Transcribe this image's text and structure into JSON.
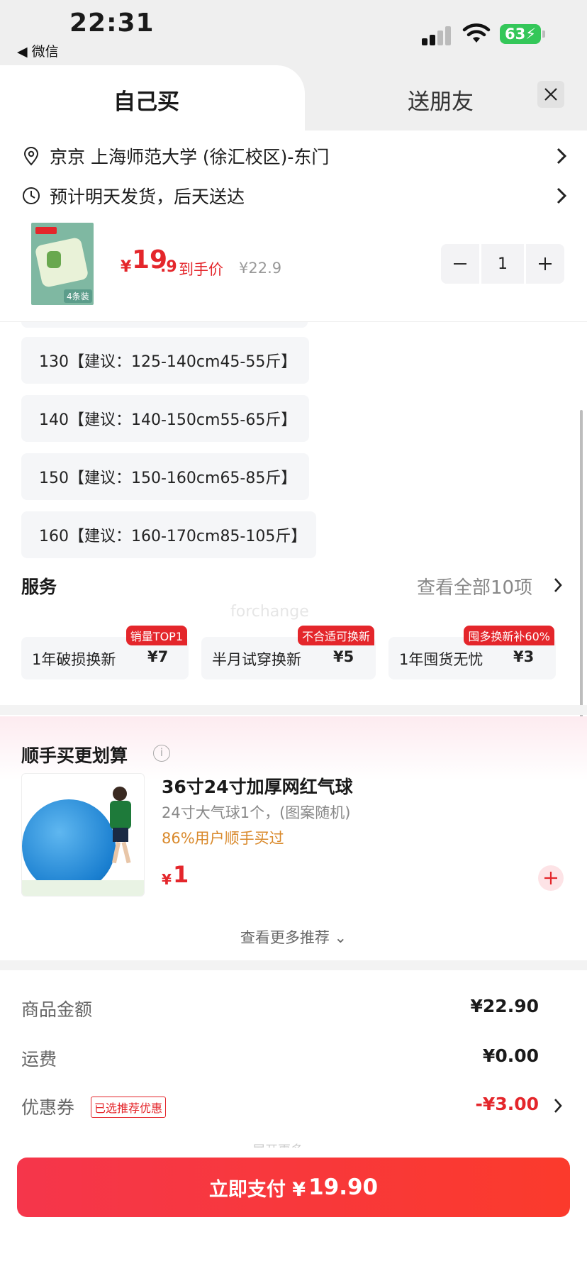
{
  "status_bar": {
    "time": "22:31",
    "back_app": "◀ 微信",
    "battery": "63"
  },
  "tabs": {
    "self": "自己买",
    "friend": "送朋友"
  },
  "address": "京京  上海师范大学 (徐汇校区)-东门",
  "delivery": "预计明天发货，后天送达",
  "product": {
    "price_currency": "¥",
    "price_int": "19",
    "price_dec": ".9",
    "price_tag": "到手价",
    "original_price": "¥22.9",
    "thumb_caption": "4条装",
    "quantity": "1"
  },
  "sizes": [
    "130【建议：125-140cm45-55斤】",
    "140【建议：140-150cm55-65斤】",
    "150【建议：150-160cm65-85斤】",
    "160【建议：160-170cm85-105斤】"
  ],
  "services": {
    "title": "服务",
    "view_all": "查看全部10项",
    "items": [
      {
        "name": "1年破损换新",
        "price": "¥7",
        "badge": "销量TOP1"
      },
      {
        "name": "半月试穿换新",
        "price": "¥5",
        "badge": "不合适可换新"
      },
      {
        "name": "1年囤货无忧",
        "price": "¥3",
        "badge": "囤多换新补60%"
      }
    ]
  },
  "watermark": "forchange",
  "bundle": {
    "title": "顺手买更划算",
    "item_name": "36寸24寸加厚网红气球",
    "item_desc": "24寸大气球1个，(图案随机)",
    "social_proof": "86%用户顺手买过",
    "price_currency": "¥",
    "price": "1",
    "more": "查看更多推荐 ⌄"
  },
  "summary": {
    "goods_label": "商品金额",
    "goods_value": "¥22.90",
    "shipping_label": "运费",
    "shipping_value": "¥0.00",
    "coupon_label": "优惠券",
    "coupon_tag": "已选推荐优惠",
    "coupon_value": "-¥3.00",
    "partial_text": "展开更多"
  },
  "pay": {
    "label": "立即支付 ¥",
    "amount": "19.90"
  }
}
